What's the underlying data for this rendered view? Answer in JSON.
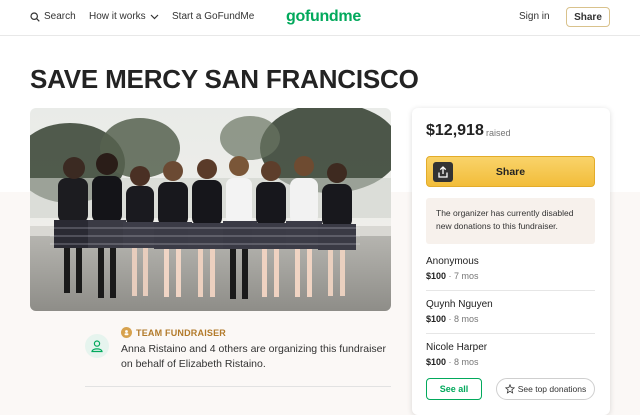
{
  "header": {
    "search_label": "Search",
    "how_it_works_label": "How it works",
    "start_label": "Start a GoFundMe",
    "logo_text": "gofundme",
    "signin_label": "Sign in",
    "share_label": "Share"
  },
  "campaign": {
    "title": "SAVE MERCY SAN FRANCISCO"
  },
  "team": {
    "badge": "TEAM FUNDRAISER",
    "text": "Anna Ristaino and 4 others are organizing this fundraiser on behalf of Elizabeth Ristaino."
  },
  "card": {
    "raised_amount": "$12,918",
    "raised_label": "raised",
    "share_label": "Share",
    "notice": "The organizer has currently disabled new donations to this fundraiser.",
    "donors": [
      {
        "name": "Anonymous",
        "amount": "$100",
        "time": "7 mos"
      },
      {
        "name": "Quynh Nguyen",
        "amount": "$100",
        "time": "8 mos"
      },
      {
        "name": "Nicole Harper",
        "amount": "$100",
        "time": "8 mos"
      }
    ],
    "see_all_label": "See all",
    "see_top_label": "See top donations"
  },
  "colors": {
    "brand_green": "#02a95c",
    "share_yellow": "#f2bd3a",
    "team_gold": "#b27a2a"
  }
}
